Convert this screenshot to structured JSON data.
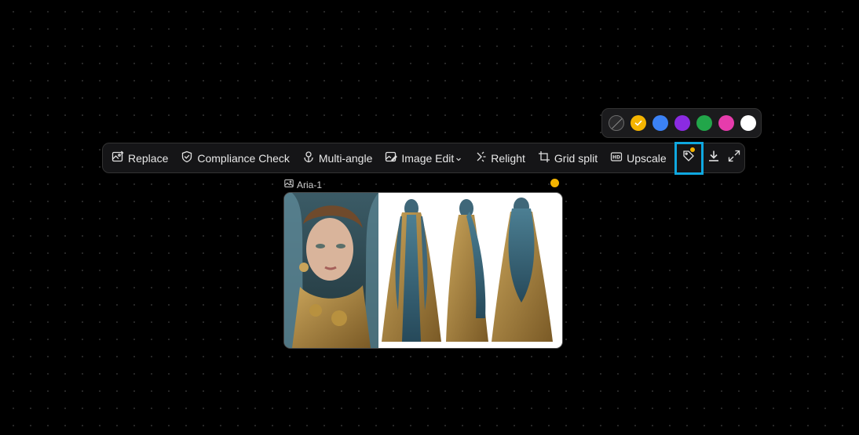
{
  "palette": {
    "swatches": [
      {
        "name": "none",
        "color": "#2a2a2c",
        "selected": false
      },
      {
        "name": "yellow",
        "color": "#f4b400",
        "selected": true
      },
      {
        "name": "blue",
        "color": "#3b82f6",
        "selected": false
      },
      {
        "name": "purple",
        "color": "#8b2be2",
        "selected": false
      },
      {
        "name": "green",
        "color": "#22a64a",
        "selected": false
      },
      {
        "name": "pink",
        "color": "#e63cac",
        "selected": false
      },
      {
        "name": "white",
        "color": "#ffffff",
        "selected": false
      }
    ]
  },
  "toolbar": {
    "replace": "Replace",
    "compliance_check": "Compliance Check",
    "multi_angle": "Multi-angle",
    "image_edit": "Image Edit",
    "relight": "Relight",
    "grid_split": "Grid split",
    "upscale": "Upscale",
    "tag_badge_color": "#f4b400",
    "highlight_color": "#0fa8e0"
  },
  "node": {
    "title": "Aria-1",
    "status_color": "#f4b400"
  }
}
